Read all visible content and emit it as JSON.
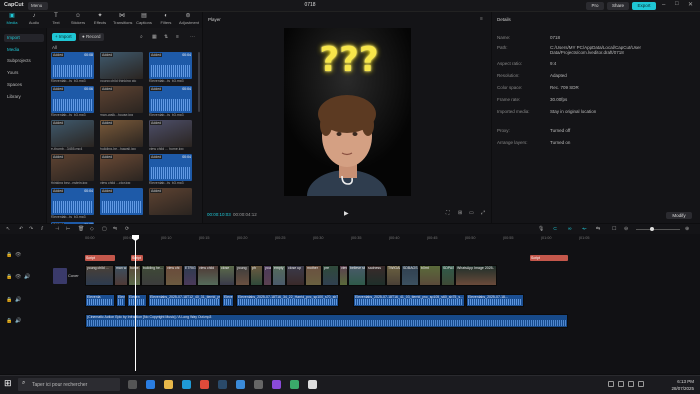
{
  "app": {
    "logo": "CapCut",
    "menu": "Menu",
    "title": "0718"
  },
  "titlebar": {
    "pro": "Pro",
    "share": "Share",
    "export": "Export"
  },
  "tools": [
    {
      "label": "Media",
      "icon": "media-icon"
    },
    {
      "label": "Audio",
      "icon": "audio-icon"
    },
    {
      "label": "Text",
      "icon": "text-icon"
    },
    {
      "label": "Stickers",
      "icon": "stickers-icon"
    },
    {
      "label": "Effects",
      "icon": "effects-icon"
    },
    {
      "label": "Transitions",
      "icon": "transitions-icon"
    },
    {
      "label": "Captions",
      "icon": "captions-icon"
    },
    {
      "label": "Filters",
      "icon": "filters-icon"
    },
    {
      "label": "Adjustment",
      "icon": "adjustment-icon"
    }
  ],
  "sidebar": {
    "items": [
      "Import",
      "Media",
      "Subprojects",
      "Yours",
      "Spaces",
      "Library"
    ]
  },
  "media": {
    "import": "Import",
    "record": "Record",
    "all": "All",
    "items": [
      {
        "cap": "Elevenlab...ts_b3.mp3",
        "dur": "00:08",
        "kind": "audio",
        "badge": "Added"
      },
      {
        "cap": "young child thinking pic",
        "dur": "",
        "kind": "img",
        "badge": "Added"
      },
      {
        "cap": "Elevenlab...ts_b3.mp3",
        "dur": "00:04",
        "kind": "audio",
        "badge": "Added"
      },
      {
        "cap": "Elevenlab...ts_b3.mp3",
        "dur": "00:06",
        "kind": "audio",
        "badge": "Added"
      },
      {
        "cap": "man-walk...house.jpg",
        "dur": "",
        "kind": "img",
        "badge": "Added"
      },
      {
        "cap": "Elevenlab...ts_b3.mp3",
        "dur": "00:04",
        "kind": "audio",
        "badge": "Added"
      },
      {
        "cap": "e-thumb...3455.mp4",
        "dur": "",
        "kind": "img",
        "badge": "Added"
      },
      {
        "cap": "building-he...hawaii.jpg",
        "dur": "",
        "kind": "img",
        "badge": "Added"
      },
      {
        "cap": "view child ... home.jpg",
        "dur": "",
        "kind": "img",
        "badge": "Added"
      },
      {
        "cap": "thinking bey...nstein.jpg",
        "dur": "",
        "kind": "img",
        "badge": "Added"
      },
      {
        "cap": "view child ...ctor.jpg",
        "dur": "",
        "kind": "img",
        "badge": "Added"
      },
      {
        "cap": "Elevenlab...ts_b3.mp3",
        "dur": "00:04",
        "kind": "audio",
        "badge": "Added"
      },
      {
        "cap": "Elevenlab...ts_b3.mp3",
        "dur": "00:04",
        "kind": "audio",
        "badge": "Added"
      },
      {
        "cap": "",
        "dur": "",
        "kind": "audio",
        "badge": "Added"
      },
      {
        "cap": "",
        "dur": "",
        "kind": "img",
        "badge": "Added"
      },
      {
        "cap": "",
        "dur": "00:03",
        "kind": "audio",
        "badge": "Added"
      }
    ]
  },
  "player": {
    "title": "Player",
    "current": "00:00:10:03",
    "total": "00:00:04:12",
    "qmarks": "???"
  },
  "details": {
    "title": "Details",
    "rows": [
      {
        "k": "Name:",
        "v": "0718"
      },
      {
        "k": "Path:",
        "v": "C:/Users/MY PC/AppData/Local/CapCut/User Data/Projects/com.lveditor.draft/0718"
      },
      {
        "k": "Aspect ratio:",
        "v": "9:4"
      },
      {
        "k": "Resolution:",
        "v": "Adapted"
      },
      {
        "k": "Color space:",
        "v": "Rec. 709 SDR"
      },
      {
        "k": "Frame rate:",
        "v": "30.00fps"
      },
      {
        "k": "Imported media:",
        "v": "Stay in original location"
      },
      {
        "k": "Proxy:",
        "v": "Turned off"
      },
      {
        "k": "Arrange layers:",
        "v": "Turned on"
      }
    ],
    "modify": "Modify"
  },
  "timeline": {
    "ruler": [
      "00:00",
      "|00:05",
      "|00:10",
      "|00:15",
      "|00:20",
      "|00:25",
      "|00:30",
      "|00:35",
      "|00:40",
      "|00:45",
      "|00:50",
      "|00:55",
      "|01:00",
      "|01:05"
    ],
    "cover": "Cover",
    "text_clips": [
      "Script",
      "Script",
      "Script",
      "Script",
      "Script"
    ],
    "video_clips": [
      "young child ...",
      "man w...",
      "home...",
      "building he...",
      "view chi",
      "ETRIGE",
      "view child",
      "close",
      "young",
      "ph",
      "young",
      "empty",
      "close up",
      "mother",
      "pre",
      "view child",
      "believe ste",
      "sadness",
      "TWIGAME",
      "SDBAOS",
      "b0mt",
      "SDPASCS Happy Family",
      "WhatsApp Image 2025-"
    ],
    "audio_clips": [
      "Elevenla",
      "Elevi",
      "Eleven",
      "Elevenlabs_2025-07-18T12_40_31_tierrid_pvc_sp100_s70_sb...",
      "Eleve",
      "Elevenlabs_2025-07-18T16_34_22_Harrid_pvc_sp100_s70_sb75_s...",
      "Elevenlabs_2025-07-18T16_41_03_tierrid_pvc_sp105_s60_sb75_s...",
      "Elevenlabs_2025-07-18..."
    ],
    "music": "(Cinematic Action Epic by Infraction [No Copyright Music] / A Long Way Out.mp3"
  },
  "taskbar": {
    "search": "Taper ici pour rechercher",
    "time": "6:13 PM",
    "date": "28/07/2025"
  }
}
